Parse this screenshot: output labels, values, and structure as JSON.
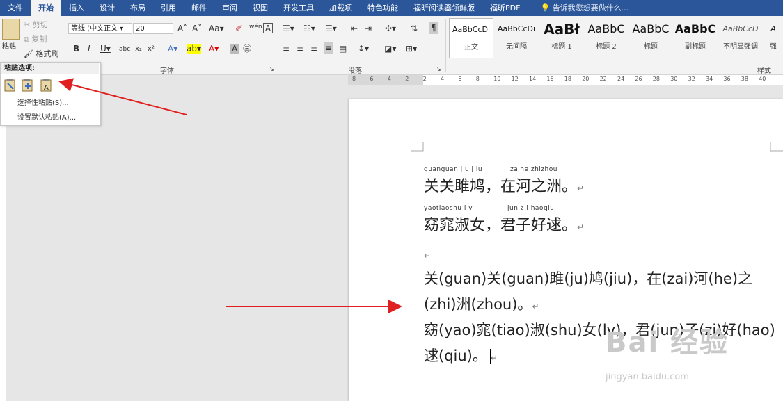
{
  "tabs": [
    "文件",
    "开始",
    "插入",
    "设计",
    "布局",
    "引用",
    "邮件",
    "审阅",
    "视图",
    "开发工具",
    "加载项",
    "特色功能",
    "福昕阅读器领鲜版",
    "福昕PDF"
  ],
  "tell_me": "告诉我您想要做什么...",
  "clipboard": {
    "paste": "粘贴",
    "cut": "剪切",
    "copy": "复制",
    "format_painter": "格式刷"
  },
  "font": {
    "name": "等线 (中文正文",
    "size": "20",
    "group_label": "字体"
  },
  "paragraph": {
    "group_label": "段落"
  },
  "styles": {
    "group_label": "样式",
    "items": [
      {
        "preview": "AaBbCcDı",
        "name": "正文"
      },
      {
        "preview": "AaBbCcDı",
        "name": "无间隔"
      },
      {
        "preview": "AaBł",
        "name": "标题 1"
      },
      {
        "preview": "AaBbC",
        "name": "标题 2"
      },
      {
        "preview": "AaBbC",
        "name": "标题"
      },
      {
        "preview": "AaBbC",
        "name": "副标题"
      },
      {
        "preview": "AaBbCcD",
        "name": "不明显强调"
      },
      {
        "preview": "A",
        "name": "强"
      }
    ]
  },
  "paste_menu": {
    "header": "粘贴选项:",
    "items": [
      "选择性粘贴(S)...",
      "设置默认粘贴(A)..."
    ]
  },
  "ruler": [
    "8",
    "6",
    "4",
    "2",
    "2",
    "4",
    "6",
    "8",
    "10",
    "12",
    "14",
    "16",
    "18",
    "20",
    "22",
    "24",
    "26",
    "28",
    "30",
    "32",
    "34",
    "36",
    "38",
    "40"
  ],
  "document": {
    "pinyin1a": "guanguan j u j iu",
    "pinyin1b": "zaihe zhizhou",
    "line1": "关关雎鸠，在河之洲。",
    "pinyin2a": "yaotiaoshu l v",
    "pinyin2b": "jun z i haoqiu",
    "line2": "窈窕淑女，君子好逑。",
    "para_mark": "↵",
    "line3": "关(guan)关(guan)雎(ju)鸠(jiu)，在(zai)河(he)之",
    "line4": "(zhi)洲(zhou)。",
    "line5": "窈(yao)窕(tiao)淑(shu)女(lv)，君(jun)子(zi)好(hao)",
    "line6": "逑(qiu)。"
  },
  "watermark": {
    "main": "Bai 经验",
    "sub": "jingyan.baidu.com"
  },
  "colors": {
    "tab_bar": "#2b579a",
    "arrow": "#e02020"
  }
}
